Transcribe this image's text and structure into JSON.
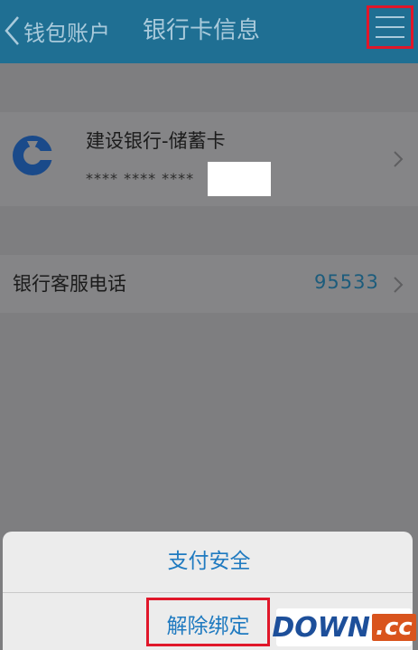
{
  "nav": {
    "back_label": "钱包账户",
    "title": "银行卡信息",
    "menu_icon": "hamburger-menu-icon"
  },
  "card": {
    "bank_name": "建设银行-储蓄卡",
    "number_masked": "**** **** ****",
    "logo_icon": "ccb-bank-logo",
    "logo_color": "#1a4a8a"
  },
  "service_phone": {
    "label": "银行客服电话",
    "value": "95533"
  },
  "action_sheet": {
    "item_payment_security": "支付安全",
    "item_unbind": "解除绑定"
  },
  "watermark": {
    "part1": "DOWN",
    "part2": ".cc"
  },
  "colors": {
    "nav_bg": "#1f6f93",
    "highlight": "#e0172a",
    "action_text": "#1f7ac0"
  }
}
